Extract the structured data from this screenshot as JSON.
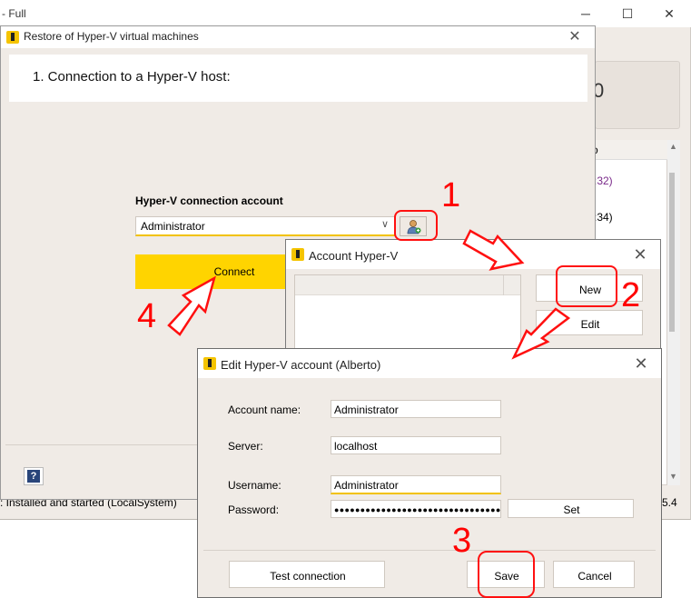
{
  "background_window": {
    "title": "- Full",
    "status_text": ": Installed and started (LocalSystem)",
    "right_list_header": "o",
    "right_list_row1": ":32)",
    "right_list_row2": ":34)",
    "version_fragment": "5.4",
    "controls": {
      "minimize": "─",
      "maximize": "☐",
      "close": "✕"
    }
  },
  "restore_dialog": {
    "title": "Restore of Hyper-V virtual machines",
    "step_title": "1. Connection to a Hyper-V host:",
    "connection_account_label": "Hyper-V connection account",
    "account_selected": "Administrator",
    "connect_label": "Connect",
    "help_label": "?"
  },
  "account_dialog": {
    "title": "Account Hyper-V",
    "new_label": "New",
    "edit_label": "Edit"
  },
  "edit_account_dialog": {
    "title": "Edit Hyper-V account (Alberto)",
    "account_name_label": "Account name:",
    "account_name_value": "Administrator",
    "server_label": "Server:",
    "server_value": "localhost",
    "username_label": "Username:",
    "username_value": "Administrator",
    "password_label": "Password:",
    "password_value": "●●●●●●●●●●●●●●●●●●●●●●●●●●●●●●●●",
    "set_label": "Set",
    "test_connection_label": "Test connection",
    "save_label": "Save",
    "cancel_label": "Cancel"
  },
  "annotations": {
    "step1": "1",
    "step2": "2",
    "step3": "3",
    "step4": "4",
    "color": "#ff0000"
  },
  "colors": {
    "accent_yellow": "#ffd400",
    "dialog_bg": "#f0ebe6"
  }
}
